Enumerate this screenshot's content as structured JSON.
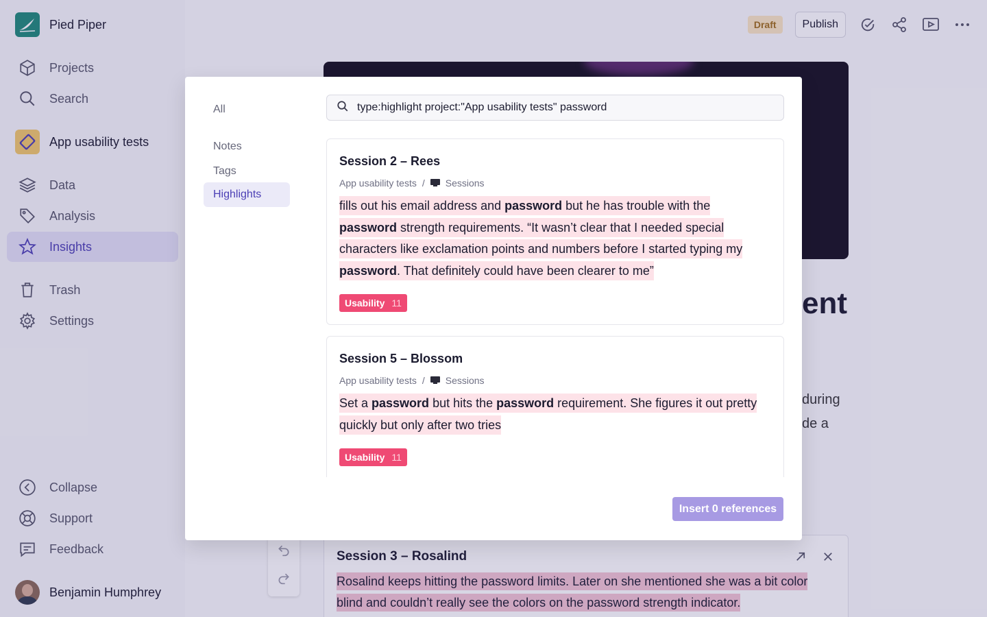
{
  "app": {
    "name": "Pied Piper"
  },
  "sidebar": {
    "nav": [
      {
        "label": "Projects",
        "icon": "box-icon"
      },
      {
        "label": "Search",
        "icon": "search-icon"
      }
    ],
    "project": {
      "label": "App usability tests",
      "icon": "project-ticket-icon"
    },
    "project_nav": [
      {
        "label": "Data",
        "icon": "layers-icon"
      },
      {
        "label": "Analysis",
        "icon": "tag-icon"
      },
      {
        "label": "Insights",
        "icon": "star-icon",
        "active": true
      }
    ],
    "util_nav": [
      {
        "label": "Trash",
        "icon": "trash-icon"
      },
      {
        "label": "Settings",
        "icon": "gear-icon"
      }
    ],
    "bottom_nav": [
      {
        "label": "Collapse",
        "icon": "chevron-left-circle-icon"
      },
      {
        "label": "Support",
        "icon": "lifebuoy-icon"
      },
      {
        "label": "Feedback",
        "icon": "message-icon"
      }
    ],
    "user": {
      "name": "Benjamin Humphrey"
    }
  },
  "topbar": {
    "status": "Draft",
    "publish_label": "Publish",
    "icons": [
      "check-circle-icon",
      "share-icon",
      "present-icon",
      "more-icon"
    ]
  },
  "document": {
    "heading_fragment": "ent",
    "body_fragments": [
      "during",
      "de a"
    ],
    "embedded_card": {
      "title": "Session 3 – Rosalind",
      "quote": "Rosalind keeps hitting the password limits. Later on she mentioned she was a bit color blind and couldn’t really see the colors on the password strength indicator."
    }
  },
  "modal": {
    "filters": [
      {
        "label": "All"
      },
      {
        "label": "Notes"
      },
      {
        "label": "Tags"
      },
      {
        "label": "Highlights",
        "active": true
      }
    ],
    "search": {
      "value": "type:highlight project:\"App usability tests\" password"
    },
    "results": [
      {
        "title": "Session 2 – Rees",
        "project": "App usability tests",
        "separator": "/",
        "folder": "Sessions",
        "quote_parts": [
          {
            "text": "fills out his email address and "
          },
          {
            "text": "password",
            "bold": true
          },
          {
            "text": " but he has trouble with the "
          },
          {
            "text": "password",
            "bold": true
          },
          {
            "text": " strength requirements. “It wasn’t clear that I needed special characters like exclamation points and numbers before I started typing my "
          },
          {
            "text": "password",
            "bold": true
          },
          {
            "text": ". That definitely could have been clearer to me”"
          }
        ],
        "tag": {
          "label": "Usability",
          "count": "11",
          "color": "#ef4a74"
        }
      },
      {
        "title": "Session 5 – Blossom",
        "project": "App usability tests",
        "separator": "/",
        "folder": "Sessions",
        "quote_parts": [
          {
            "text": "Set a "
          },
          {
            "text": "password",
            "bold": true
          },
          {
            "text": " but hits the "
          },
          {
            "text": "password",
            "bold": true
          },
          {
            "text": " requirement. She figures it out pretty quickly but only after two tries"
          }
        ],
        "tag": {
          "label": "Usability",
          "count": "11",
          "color": "#ef4a74"
        }
      }
    ],
    "insert_label": "Insert 0 references"
  },
  "colors": {
    "accent": "#4b3fb5",
    "highlight": "#fde2e8",
    "tag": "#ef4a74",
    "insert_button": "#a79ae3",
    "draft_badge_bg": "#fbe7c4",
    "brand": "#1f8a7a"
  }
}
